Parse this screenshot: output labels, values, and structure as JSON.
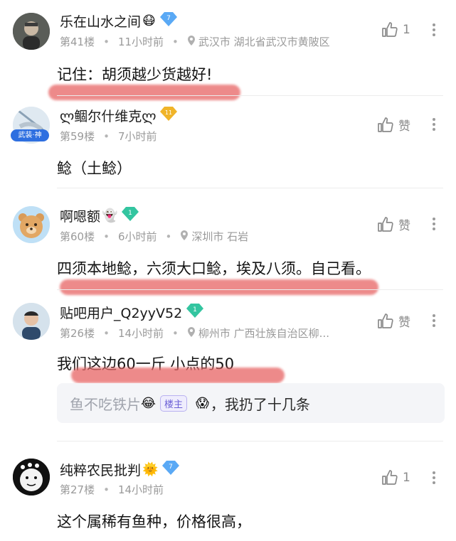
{
  "comments": [
    {
      "name": "乐在山水之间",
      "emoji": "😷",
      "level": "7",
      "floor": "第41楼",
      "time": "11小时前",
      "location": "武汉市 湖北省武汉市黄陂区",
      "likes": "1",
      "text": "记住：胡须越少货越好!"
    },
    {
      "name": "ლ鲴尔什维克ლ",
      "level": "11",
      "avatar_tag": "武装·神",
      "floor": "第59楼",
      "time": "7小时前",
      "likes": "赞",
      "text": "鲶（土鲶）"
    },
    {
      "name": "啊嗯额",
      "emoji": "👻",
      "level": "1",
      "floor": "第60楼",
      "time": "6小时前",
      "location": "深圳市 石岩",
      "likes": "赞",
      "text": "四须本地鲶，六须大口鲶，埃及八须。自己看。"
    },
    {
      "name": "贴吧用户_Q2yyV52",
      "level": "1",
      "floor": "第26楼",
      "time": "14小时前",
      "location": "柳州市 广西壮族自治区柳...",
      "likes": "赞",
      "text": "我们这边60一斤 小点的50",
      "reply": {
        "author": "鱼不吃铁片",
        "author_emoji": "😂",
        "badge": "楼主",
        "emoji": "😱",
        "text": "，我扔了十几条"
      }
    },
    {
      "name": "纯粹农民批判",
      "emoji": "🌞",
      "level": "7",
      "floor": "第27楼",
      "time": "14小时前",
      "likes": "1",
      "text": "这个属稀有鱼种，价格很高，"
    }
  ],
  "colors": {
    "level_blue": "#5aa9f5",
    "level_gold": "#f0b429",
    "level_green": "#33c5a0",
    "redaction": "#e86a6a",
    "badge": "#6b5fd6"
  },
  "icons": {
    "like": "thumbs-up-icon",
    "more": "more-vertical-icon",
    "location": "location-pin-icon",
    "level": "diamond-level-icon"
  }
}
